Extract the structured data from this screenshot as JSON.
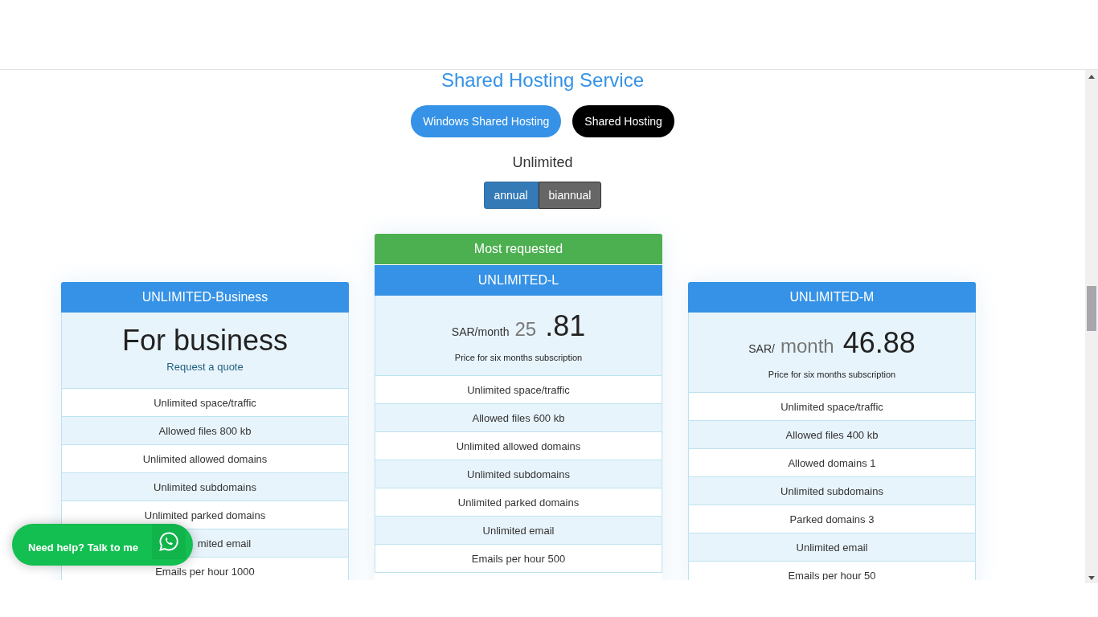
{
  "title": "Shared Hosting Service",
  "hosting_tabs": [
    {
      "label": "Windows Shared Hosting",
      "selected": false
    },
    {
      "label": "Shared Hosting",
      "selected": true
    }
  ],
  "plan_group": "Unlimited",
  "billing_toggle": [
    {
      "label": "annual",
      "selected": true
    },
    {
      "label": "biannual",
      "selected": false
    }
  ],
  "plans": [
    {
      "name": "UNLIMITED-Business",
      "featured": false,
      "price": [
        {
          "kind": "headline",
          "text": "For business"
        }
      ],
      "quote_link": "Request a quote",
      "features": [
        {
          "text": "Unlimited space/traffic"
        },
        {
          "text": "Allowed files 800 kb"
        },
        {
          "text": "Unlimited allowed domains"
        },
        {
          "text": "Unlimited subdomains"
        },
        {
          "text": "Unlimited parked domains"
        },
        {
          "text": "mited email",
          "kind": "partly-covered"
        },
        {
          "text": "Emails per hour 1000"
        }
      ]
    },
    {
      "name": "UNLIMITED-L",
      "featured": true,
      "badge": "Most requested",
      "price": [
        {
          "kind": "unit",
          "text": "SAR/month"
        },
        {
          "kind": "minor",
          "text": "25"
        },
        {
          "kind": "major",
          "text": ".81"
        }
      ],
      "caption": "Price for six months subscription",
      "features": [
        {
          "text": "Unlimited space/traffic"
        },
        {
          "text": "Allowed files 600 kb"
        },
        {
          "text": "Unlimited allowed domains"
        },
        {
          "text": "Unlimited subdomains"
        },
        {
          "text": "Unlimited parked domains"
        },
        {
          "text": "Unlimited email"
        },
        {
          "text": "Emails per hour 500"
        }
      ]
    },
    {
      "name": "UNLIMITED-M",
      "featured": false,
      "price": [
        {
          "kind": "unit",
          "text": "SAR/"
        },
        {
          "kind": "minor",
          "text": "month"
        },
        {
          "kind": "major",
          "text": "46.88"
        }
      ],
      "caption": "Price for six months subscription",
      "features": [
        {
          "text": "Unlimited space/traffic"
        },
        {
          "text": "Allowed files 400 kb"
        },
        {
          "text": "Allowed domains 1"
        },
        {
          "text": "Unlimited subdomains"
        },
        {
          "text": "Parked domains 3"
        },
        {
          "text": "Unlimited email"
        },
        {
          "text": "Emails per hour 50"
        }
      ]
    }
  ],
  "help_widget": {
    "label": "Need help? Talk to me"
  }
}
